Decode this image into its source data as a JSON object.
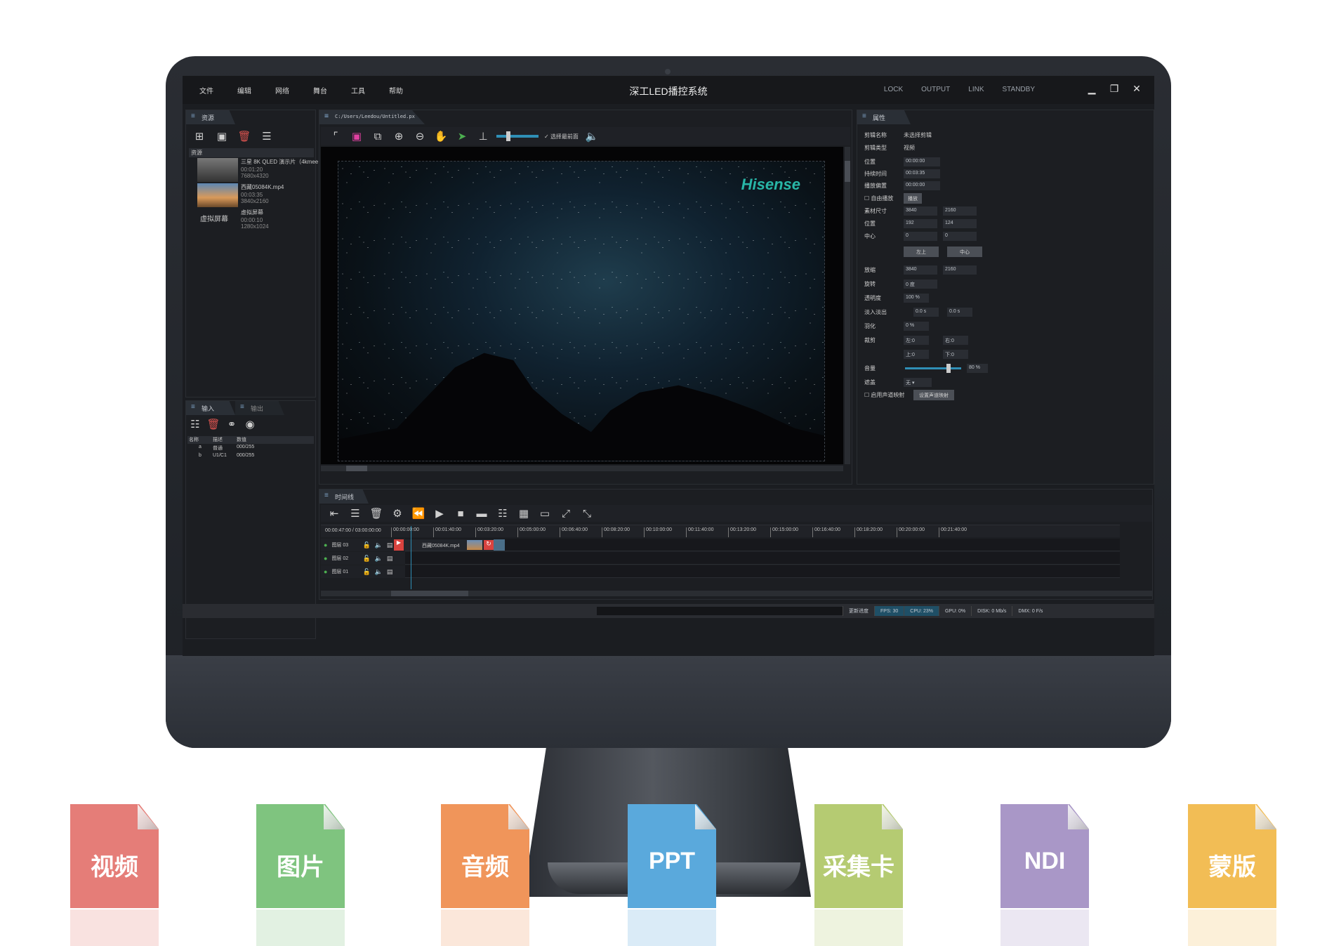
{
  "app": {
    "title": "深工LED播控系统",
    "menu": [
      "文件",
      "编辑",
      "网络",
      "舞台",
      "工具",
      "帮助"
    ],
    "top_right": [
      "LOCK",
      "OUTPUT",
      "LINK",
      "STANDBY"
    ],
    "window_buttons": [
      "▁",
      "❐",
      "✕"
    ]
  },
  "resources": {
    "tab": "资源",
    "header": "资源",
    "items": [
      {
        "name": "三星 8K QLED 演示片（4kmee，co",
        "duration": "00:01:20",
        "size": "7680x4320"
      },
      {
        "name": "西藏05084K.mp4",
        "duration": "00:03:35",
        "size": "3840x2160"
      },
      {
        "name": "虚拟屏幕",
        "label": "虚拟屏幕",
        "duration": "00:00:10",
        "size": "1280x1024"
      }
    ]
  },
  "io": {
    "tab_in": "输入",
    "tab_out": "输出",
    "columns": [
      "名称",
      "描述",
      "数值"
    ],
    "rows": [
      {
        "name": "a",
        "desc": "普通",
        "value": "000/255"
      },
      {
        "name": "b",
        "desc": "U1/C1",
        "value": "000/255"
      }
    ]
  },
  "viewer": {
    "tab": "C:/Users/Leedou/Untitled.px",
    "option": "选择最前面",
    "brand": "Hisense"
  },
  "properties": {
    "tab": "属性",
    "clip_name_label": "剪辑名称",
    "clip_name": "未选择剪辑",
    "clip_type_label": "剪辑类型",
    "clip_type": "视频",
    "position_label": "位置",
    "position": "00:00:00",
    "duration_label": "持续时间",
    "duration": "00:03:35",
    "offset_label": "播放偏置",
    "offset": "00:00:00",
    "free_play": "自由播放",
    "play_btn": "播放",
    "material_size_label": "素材尺寸",
    "material_w": "3840",
    "material_h": "2160",
    "pos_label": "位置",
    "pos_x": "192",
    "pos_y": "124",
    "center_label": "中心",
    "center_x": "0",
    "center_y": "0",
    "btn_topleft": "左上",
    "btn_center": "中心",
    "scale_label": "放缩",
    "scale_w": "3840",
    "scale_h": "2160",
    "rotate_label": "旋转",
    "rotate": "0 度",
    "opacity_label": "透明度",
    "opacity": "100 %",
    "fade_label": "淡入淡出",
    "fade_in": "0.0 s",
    "fade_out": "0.0 s",
    "feather_label": "羽化",
    "feather": "0 %",
    "crop_label": "裁剪",
    "crop_left": "左:0",
    "crop_right": "右:0",
    "crop_top": "上:0",
    "crop_bottom": "下:0",
    "volume_label": "音量",
    "volume": "80 %",
    "volume_level": 0.8,
    "mask_label": "遮盖",
    "mask": "无",
    "audio_map": "启用声道映射",
    "audio_map_btn": "设置声道映射"
  },
  "timeline": {
    "tab": "时间线",
    "time": "00:00:47:00 / 03:00:00:00",
    "ticks": [
      "00:00:00:00",
      "00:01:40:00",
      "00:03:20:00",
      "00:05:00:00",
      "00:06:40:00",
      "00:08:20:00",
      "00:10:00:00",
      "00:11:40:00",
      "00:13:20:00",
      "00:15:00:00",
      "00:16:40:00",
      "00:18:20:00",
      "00:20:00:00",
      "00:21:40:00"
    ],
    "layers": [
      {
        "name": "图层 03"
      },
      {
        "name": "图层 02"
      },
      {
        "name": "图层 01"
      }
    ],
    "clip_name": "西藏05084K.mp4"
  },
  "status": {
    "progress": "更新进度",
    "fps": "FPS: 30",
    "cpu": "CPU: 23%",
    "gpu": "GPU: 0%",
    "disk": "DISK: 0 Mb/s",
    "dmx": "DMX: 0 F/s"
  },
  "formats": [
    {
      "label": "视频",
      "color": "#e57d78"
    },
    {
      "label": "图片",
      "color": "#7fc47f"
    },
    {
      "label": "音频",
      "color": "#f0955a"
    },
    {
      "label": "PPT",
      "color": "#5aa9dc"
    },
    {
      "label": "采集卡",
      "color": "#b5cb72"
    },
    {
      "label": "NDI",
      "color": "#a997c7"
    },
    {
      "label": "蒙版",
      "color": "#f2bd55"
    }
  ]
}
